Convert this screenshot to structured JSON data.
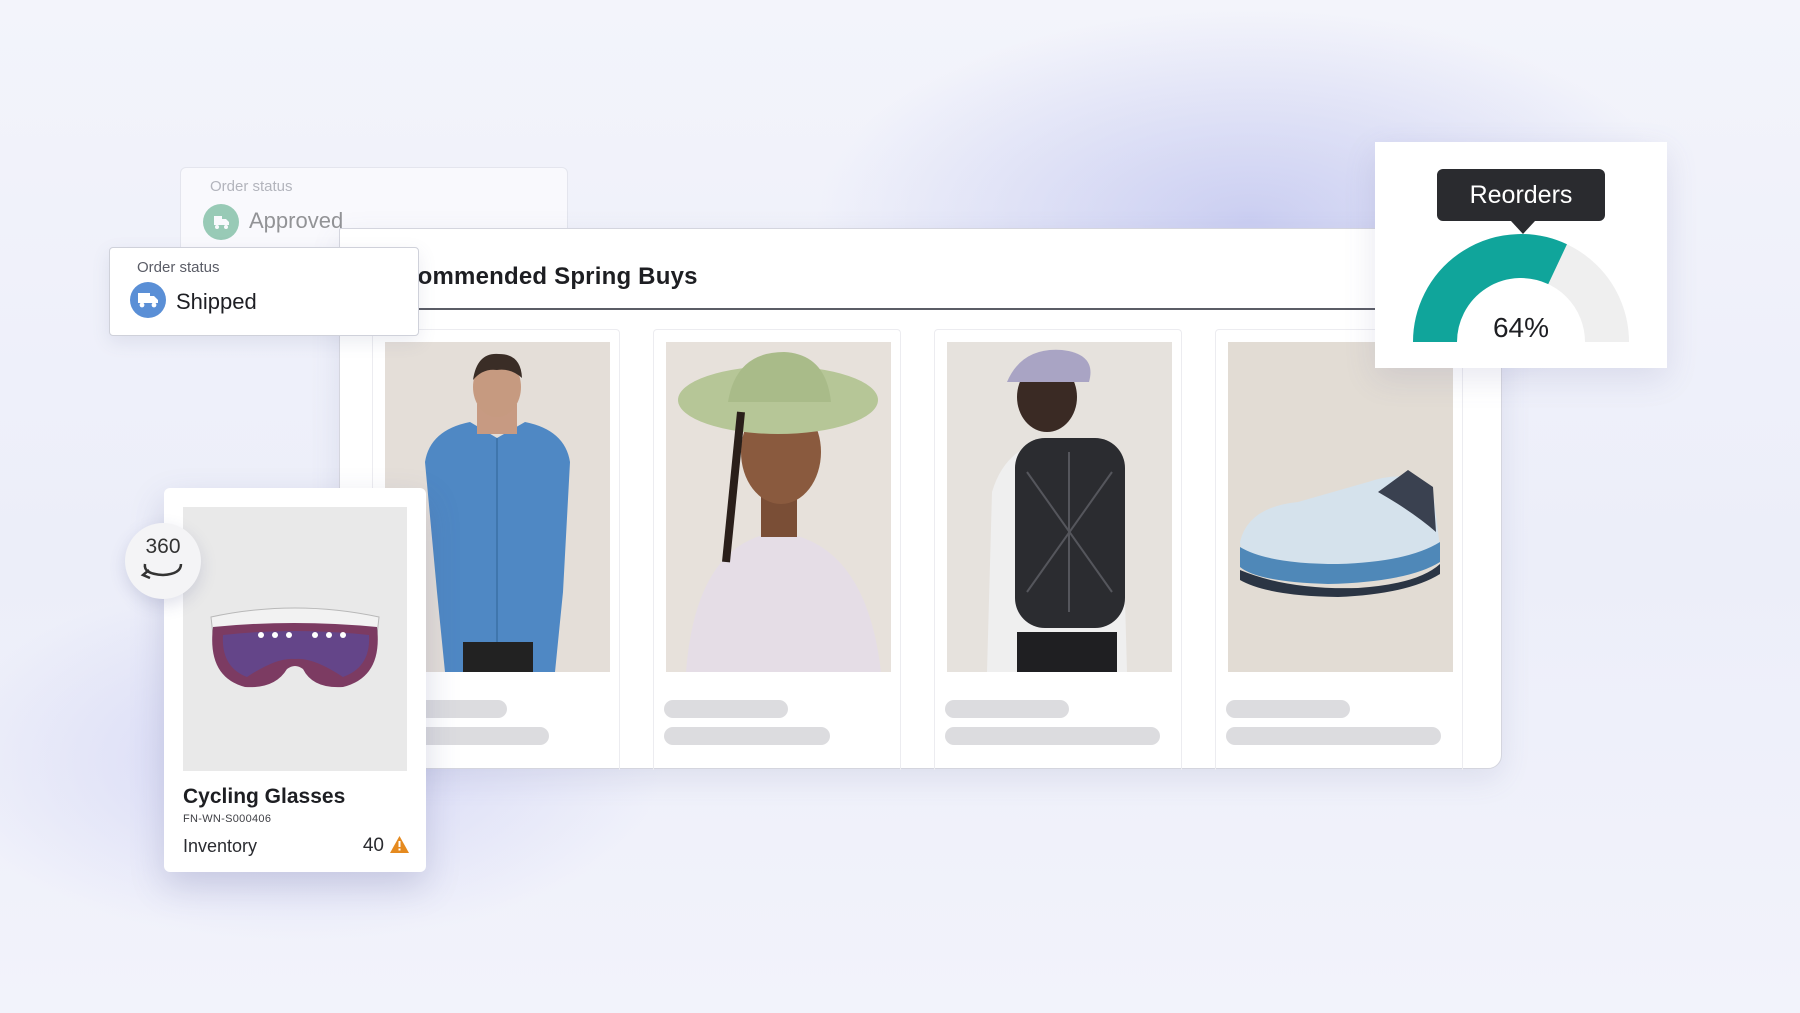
{
  "order_status_back": {
    "label": "Order status",
    "value": "Approved",
    "icon": "truck-check-icon"
  },
  "order_status_front": {
    "label": "Order status",
    "value": "Shipped",
    "icon": "truck-icon"
  },
  "panel": {
    "title": "Recommended Spring Buys",
    "products": [
      {
        "image": "man-blue-jacket"
      },
      {
        "image": "woman-sun-hat"
      },
      {
        "image": "woman-backpack"
      },
      {
        "image": "blue-trail-shoe"
      }
    ]
  },
  "reorders": {
    "label": "Reorders",
    "value_text": "64%",
    "value": 0.64,
    "fill_color": "#10a59b",
    "track_color": "#efefef"
  },
  "product_card": {
    "badge": "360",
    "name": "Cycling Glasses",
    "sku": "FN-WN-S000406",
    "inventory_label": "Inventory",
    "inventory_value": "40",
    "warning_color": "#e58a1f"
  }
}
